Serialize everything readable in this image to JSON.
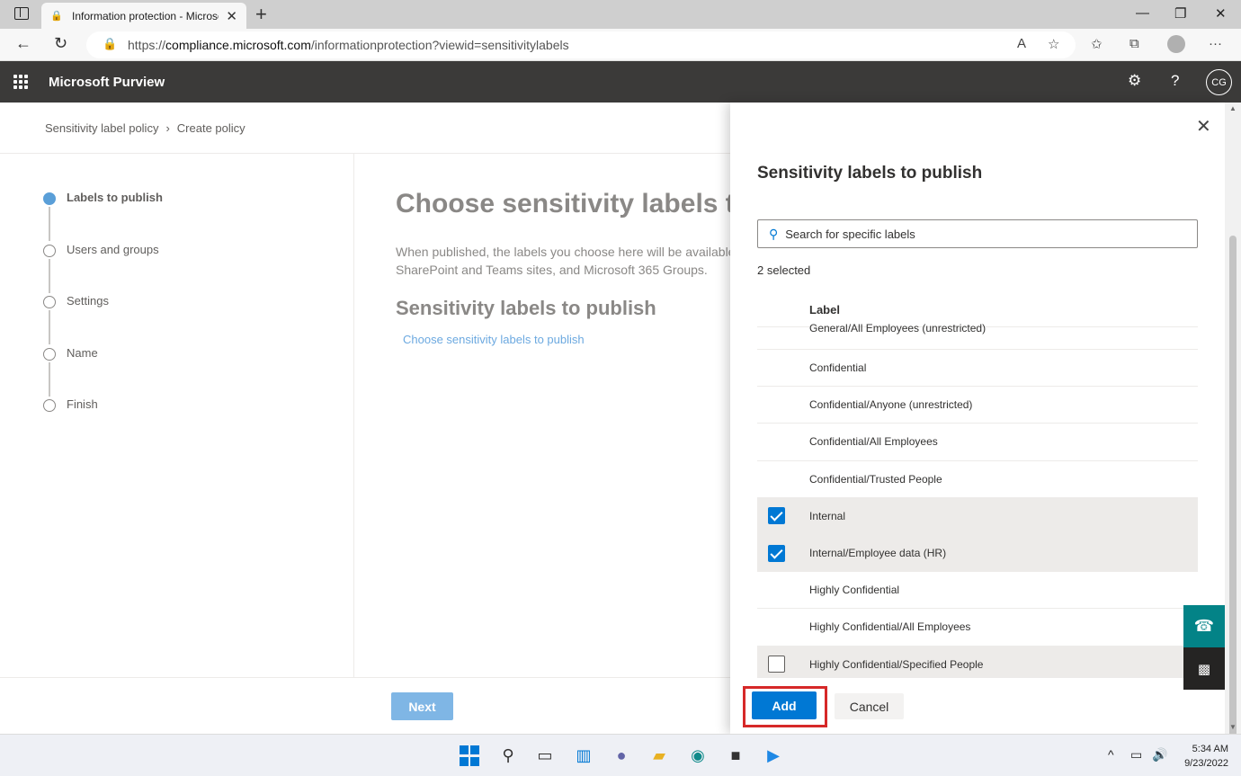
{
  "browser": {
    "tab_title": "Information protection - Microsoft",
    "url_prefix": "https://",
    "url_host": "compliance.microsoft.com",
    "url_path": "/informationprotection?viewid=sensitivitylabels"
  },
  "app": {
    "title": "Microsoft Purview",
    "avatar_initials": "CG"
  },
  "breadcrumb": {
    "items": [
      "Sensitivity label policy",
      "Create policy"
    ]
  },
  "steps": [
    {
      "label": "Labels to publish",
      "active": true
    },
    {
      "label": "Users and groups",
      "active": false
    },
    {
      "label": "Settings",
      "active": false
    },
    {
      "label": "Name",
      "active": false
    },
    {
      "label": "Finish",
      "active": false
    }
  ],
  "main": {
    "title": "Choose sensitivity labels to publish",
    "desc_line1": "When published, the labels you choose here will be available",
    "desc_line2": "SharePoint and Teams sites, and Microsoft 365 Groups.",
    "section_title": "Sensitivity labels to publish",
    "choose_link": "Choose sensitivity labels to publish",
    "next_label": "Next"
  },
  "panel": {
    "title": "Sensitivity labels to publish",
    "search_placeholder": "Search for specific labels",
    "selected_count": "2 selected",
    "column_header": "Label",
    "rows": [
      {
        "label": "General/All Employees (unrestricted)",
        "selected": false
      },
      {
        "label": "Confidential",
        "selected": false
      },
      {
        "label": "Confidential/Anyone (unrestricted)",
        "selected": false
      },
      {
        "label": "Confidential/All Employees",
        "selected": false
      },
      {
        "label": "Confidential/Trusted People",
        "selected": false
      },
      {
        "label": "Internal",
        "selected": true
      },
      {
        "label": "Internal/Employee data (HR)",
        "selected": true
      },
      {
        "label": "Highly Confidential",
        "selected": false
      },
      {
        "label": "Highly Confidential/All Employees",
        "selected": false
      },
      {
        "label": "Highly Confidential/Specified People",
        "selected": false
      }
    ],
    "add_label": "Add",
    "cancel_label": "Cancel"
  },
  "taskbar": {
    "time": "5:34 AM",
    "date": "9/23/2022"
  },
  "colors": {
    "accent": "#0078d4",
    "header_bg": "#3b3a39",
    "highlight": "#d62828"
  }
}
